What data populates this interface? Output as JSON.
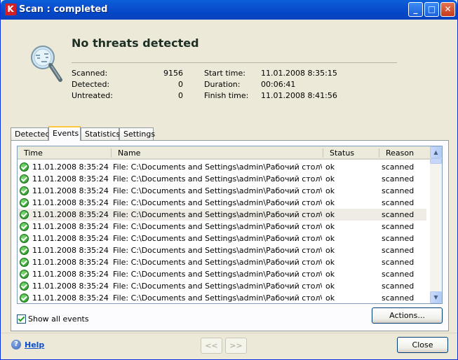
{
  "window": {
    "title": "Scan : completed",
    "app_icon": "kaspersky-k-icon"
  },
  "summary": {
    "headline": "No threats detected",
    "scanned_label": "Scanned:",
    "scanned_value": "9156",
    "detected_label": "Detected:",
    "detected_value": "0",
    "untreated_label": "Untreated:",
    "untreated_value": "0",
    "start_label": "Start time:",
    "start_value": "11.01.2008 8:35:15",
    "duration_label": "Duration:",
    "duration_value": "00:06:41",
    "finish_label": "Finish time:",
    "finish_value": "11.01.2008 8:41:56"
  },
  "tabs": [
    {
      "label": "Detected",
      "active": false
    },
    {
      "label": "Events",
      "active": true
    },
    {
      "label": "Statistics",
      "active": false
    },
    {
      "label": "Settings",
      "active": false
    }
  ],
  "events": {
    "columns": [
      "Time",
      "Name",
      "Status",
      "Reason"
    ],
    "rows": [
      [
        "11.01.2008 8:35:24",
        "File: C:\\Documents and Settings\\admin\\Рабочий стол\\To s...",
        "ok",
        "scanned"
      ],
      [
        "11.01.2008 8:35:24",
        "File: C:\\Documents and Settings\\admin\\Рабочий стол\\To s...",
        "ok",
        "scanned"
      ],
      [
        "11.01.2008 8:35:24",
        "File: C:\\Documents and Settings\\admin\\Рабочий стол\\To s...",
        "ok",
        "scanned"
      ],
      [
        "11.01.2008 8:35:24",
        "File: C:\\Documents and Settings\\admin\\Рабочий стол\\To s...",
        "ok",
        "scanned"
      ],
      [
        "11.01.2008 8:35:24",
        "File: C:\\Documents and Settings\\admin\\Рабочий стол\\To s...",
        "ok",
        "scanned"
      ],
      [
        "11.01.2008 8:35:24",
        "File: C:\\Documents and Settings\\admin\\Рабочий стол\\To s...",
        "ok",
        "scanned"
      ],
      [
        "11.01.2008 8:35:24",
        "File: C:\\Documents and Settings\\admin\\Рабочий стол\\To s...",
        "ok",
        "scanned"
      ],
      [
        "11.01.2008 8:35:24",
        "File: C:\\Documents and Settings\\admin\\Рабочий стол\\To s...",
        "ok",
        "scanned"
      ],
      [
        "11.01.2008 8:35:24",
        "File: C:\\Documents and Settings\\admin\\Рабочий стол\\To s...",
        "ok",
        "scanned"
      ],
      [
        "11.01.2008 8:35:24",
        "File: C:\\Documents and Settings\\admin\\Рабочий стол\\To s...",
        "ok",
        "scanned"
      ],
      [
        "11.01.2008 8:35:24",
        "File: C:\\Documents and Settings\\admin\\Рабочий стол\\To s...",
        "ok",
        "scanned"
      ],
      [
        "11.01.2008 8:35:24",
        "File: C:\\Documents and Settings\\admin\\Рабочий стол\\To s...",
        "ok",
        "scanned"
      ]
    ],
    "selected_row": 4,
    "row_icon": "ok-check-icon"
  },
  "options": {
    "show_all_label": "Show all events",
    "show_all_checked": true
  },
  "buttons": {
    "actions": "Actions...",
    "back": "<<",
    "forward": ">>",
    "close": "Close",
    "help": "Help"
  },
  "colors": {
    "title_bar": "#0a5fd8",
    "window_bg": "#ece9d8",
    "headline": "#1d2f24",
    "link": "#0b4ed2",
    "tab_highlight": "#ffc83c"
  }
}
